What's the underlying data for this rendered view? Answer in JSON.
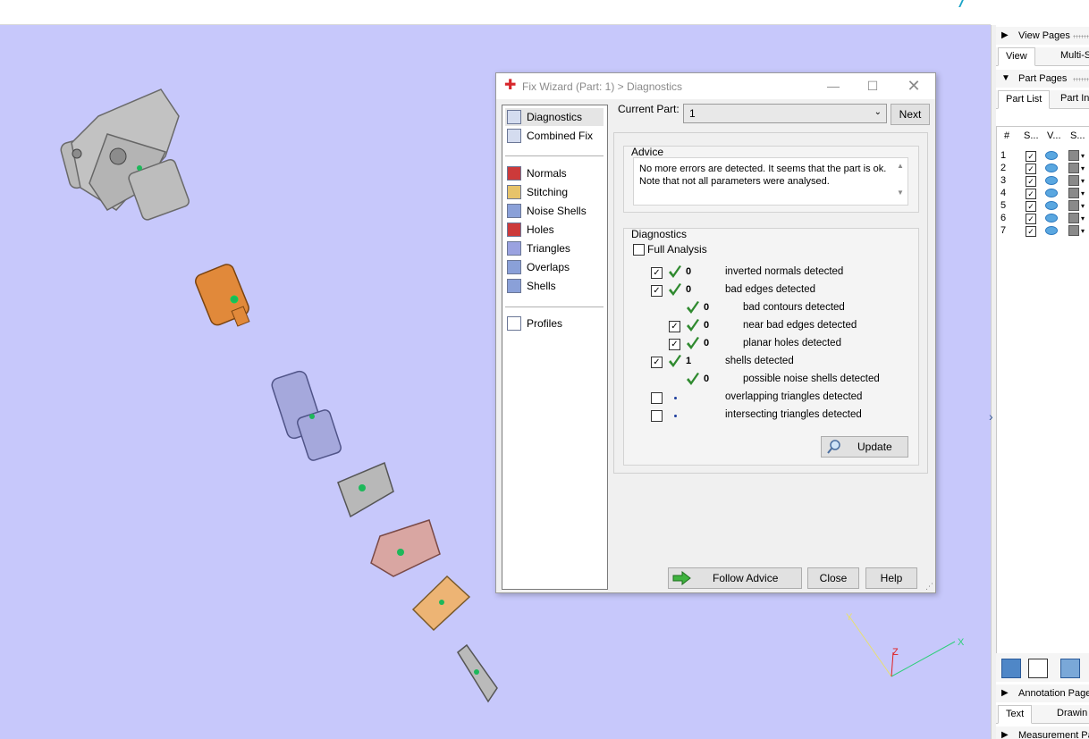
{
  "dialog": {
    "title": "Fix Wizard (Part: 1) > Diagnostics",
    "nav": [
      {
        "label": "Diagnostics",
        "icon": "magnifier-icon"
      },
      {
        "label": "Combined Fix",
        "icon": "combined-fix-icon"
      },
      {
        "label": "Normals",
        "icon": "normals-icon"
      },
      {
        "label": "Stitching",
        "icon": "stitching-icon"
      },
      {
        "label": "Noise Shells",
        "icon": "noise-shells-icon"
      },
      {
        "label": "Holes",
        "icon": "holes-icon"
      },
      {
        "label": "Triangles",
        "icon": "triangles-icon"
      },
      {
        "label": "Overlaps",
        "icon": "overlaps-icon"
      },
      {
        "label": "Shells",
        "icon": "shells-icon"
      },
      {
        "label": "Profiles",
        "icon": "profiles-icon"
      }
    ],
    "current_part_label": "Current Part:",
    "current_part_value": "1",
    "next_label": "Next",
    "advice_title": "Advice",
    "advice_line1": "No more errors are detected. It seems that the part is ok.",
    "advice_line2": "Note that not all parameters were analysed.",
    "diagnostics_title": "Diagnostics",
    "full_analysis_label": "Full Analysis",
    "rows": [
      {
        "checked": true,
        "status": "ok",
        "count": "0",
        "label": "inverted normals detected",
        "indent": 0,
        "has_checkbox": true
      },
      {
        "checked": true,
        "status": "ok",
        "count": "0",
        "label": "bad edges detected",
        "indent": 0,
        "has_checkbox": true
      },
      {
        "checked": false,
        "status": "ok",
        "count": "0",
        "label": "bad contours detected",
        "indent": 1,
        "has_checkbox": false
      },
      {
        "checked": true,
        "status": "ok",
        "count": "0",
        "label": "near bad edges detected",
        "indent": 1,
        "has_checkbox": true
      },
      {
        "checked": true,
        "status": "ok",
        "count": "0",
        "label": "planar holes detected",
        "indent": 1,
        "has_checkbox": true
      },
      {
        "checked": true,
        "status": "ok",
        "count": "1",
        "label": "shells detected",
        "indent": 0,
        "has_checkbox": true
      },
      {
        "checked": false,
        "status": "ok",
        "count": "0",
        "label": "possible noise shells detected",
        "indent": 1,
        "has_checkbox": false
      },
      {
        "checked": false,
        "status": "none",
        "count": "",
        "label": "overlapping triangles detected",
        "indent": 0,
        "has_checkbox": true
      },
      {
        "checked": false,
        "status": "none",
        "count": "",
        "label": "intersecting triangles detected",
        "indent": 0,
        "has_checkbox": true
      }
    ],
    "update_label": "Update",
    "follow_advice_label": "Follow Advice",
    "close_label": "Close",
    "help_label": "Help"
  },
  "right_panel": {
    "view_pages": "View Pages",
    "view_tab": "View",
    "multi_tab": "Multi-S",
    "part_pages": "Part Pages",
    "part_list_tab": "Part List",
    "part_info_tab": "Part In",
    "col_num": "#",
    "col_s": "S...",
    "col_v": "V...",
    "col_s2": "S...",
    "parts": [
      "1",
      "2",
      "3",
      "4",
      "5",
      "6",
      "7"
    ],
    "annotation_pages": "Annotation Page",
    "text_tab": "Text",
    "drawing_tab": "Drawin",
    "measurement_pages": "Measurement Pa"
  },
  "axes": {
    "x": "X",
    "y": "Y",
    "z": "Z"
  },
  "colors": {
    "viewport": "#c7c8fb",
    "check_green": "#2f8a2f",
    "part_orange": "#e1893a",
    "part_grey": "#b8b8b8",
    "part_lavender": "#a5a8dc",
    "part_pink": "#d9a6a2",
    "part_peach": "#edb474"
  }
}
